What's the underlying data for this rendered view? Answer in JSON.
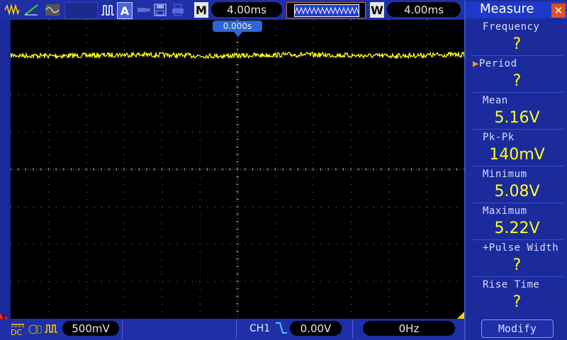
{
  "toolbar": {
    "mode_icons": [
      "acquire-normal-icon",
      "acquire-peak-icon",
      "acquire-average-icon"
    ],
    "trigger_mode": "A",
    "main_label": "M",
    "main_timebase": "4.00ms",
    "window_label": "W",
    "window_timebase": "4.00ms"
  },
  "scope": {
    "trigger_position": "0.000s",
    "trace_color": "#ffff20",
    "grid_color": "#8a8a8a"
  },
  "measure_panel": {
    "title": "Measure",
    "items": [
      {
        "label": "Frequency",
        "value": "?",
        "selected": false
      },
      {
        "label": "Period",
        "value": "?",
        "selected": true
      },
      {
        "label": "Mean",
        "value": "5.16V",
        "selected": false
      },
      {
        "label": "Pk-Pk",
        "value": "140mV",
        "selected": false
      },
      {
        "label": "Minimum",
        "value": "5.08V",
        "selected": false
      },
      {
        "label": "Maximum",
        "value": "5.22V",
        "selected": false
      },
      {
        "label": "+Pulse Width",
        "value": "?",
        "selected": false
      },
      {
        "label": "Rise Time",
        "value": "?",
        "selected": false
      }
    ],
    "modify_label": "Modify"
  },
  "status_bar": {
    "coupling": "DC",
    "volts_per_div": "500mV",
    "channel": "CH1",
    "trigger_level": "0.00V",
    "frequency": "0Hz"
  },
  "channel_marker": "1"
}
